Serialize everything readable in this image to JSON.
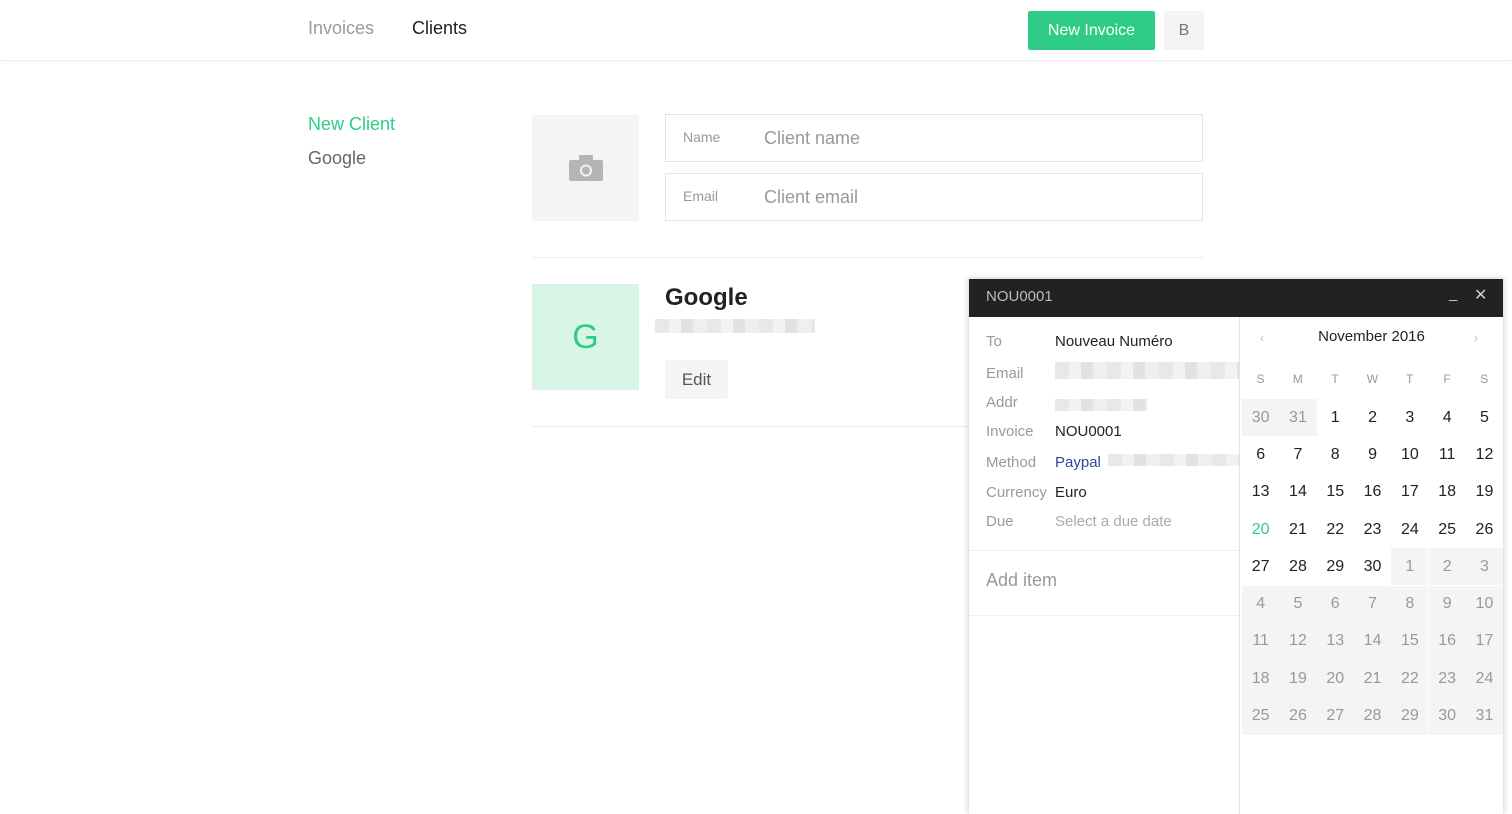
{
  "topbar": {
    "nav": [
      "Invoices",
      "Clients"
    ],
    "new_invoice_label": "New Invoice",
    "user_initial": "B"
  },
  "sidebar": {
    "items": [
      {
        "label": "New Client",
        "active": true
      },
      {
        "label": "Google",
        "active": false
      }
    ]
  },
  "new_client_form": {
    "name_label": "Name",
    "name_placeholder": "Client name",
    "email_label": "Email",
    "email_placeholder": "Client email",
    "photo_icon": "camera-icon"
  },
  "client_card": {
    "avatar_letter": "G",
    "name": "Google",
    "edit_label": "Edit"
  },
  "invoice_popup": {
    "title": "NOU0001",
    "minimize_glyph": "_",
    "close_glyph": "✕",
    "rows": {
      "to_label": "To",
      "to_value": "Nouveau Numéro",
      "email_label": "Email",
      "addr_label": "Addr",
      "invoice_label": "Invoice",
      "invoice_value": "NOU0001",
      "method_label": "Method",
      "method_value": "Paypal",
      "currency_label": "Currency",
      "currency_value": "Euro",
      "due_label": "Due",
      "due_placeholder": "Select a due date"
    },
    "add_item_label": "Add item"
  },
  "calendar": {
    "month_title": "November 2016",
    "prev_glyph": "‹",
    "next_glyph": "›",
    "weekdays": [
      "S",
      "M",
      "T",
      "W",
      "T",
      "F",
      "S"
    ],
    "today": 20,
    "weeks": [
      [
        [
          30,
          "other"
        ],
        [
          31,
          "other"
        ],
        [
          1,
          "in"
        ],
        [
          2,
          "in"
        ],
        [
          3,
          "in"
        ],
        [
          4,
          "in"
        ],
        [
          5,
          "in"
        ]
      ],
      [
        [
          6,
          "in"
        ],
        [
          7,
          "in"
        ],
        [
          8,
          "in"
        ],
        [
          9,
          "in"
        ],
        [
          10,
          "in"
        ],
        [
          11,
          "in"
        ],
        [
          12,
          "in"
        ]
      ],
      [
        [
          13,
          "in"
        ],
        [
          14,
          "in"
        ],
        [
          15,
          "in"
        ],
        [
          16,
          "in"
        ],
        [
          17,
          "in"
        ],
        [
          18,
          "in"
        ],
        [
          19,
          "in"
        ]
      ],
      [
        [
          20,
          "today"
        ],
        [
          21,
          "in"
        ],
        [
          22,
          "in"
        ],
        [
          23,
          "in"
        ],
        [
          24,
          "in"
        ],
        [
          25,
          "in"
        ],
        [
          26,
          "in"
        ]
      ],
      [
        [
          27,
          "in"
        ],
        [
          28,
          "in"
        ],
        [
          29,
          "in"
        ],
        [
          30,
          "in"
        ],
        [
          1,
          "other"
        ],
        [
          2,
          "other"
        ],
        [
          3,
          "other"
        ]
      ],
      [
        [
          4,
          "other"
        ],
        [
          5,
          "other"
        ],
        [
          6,
          "other"
        ],
        [
          7,
          "other"
        ],
        [
          8,
          "other"
        ],
        [
          9,
          "other"
        ],
        [
          10,
          "other"
        ]
      ],
      [
        [
          11,
          "other"
        ],
        [
          12,
          "other"
        ],
        [
          13,
          "other"
        ],
        [
          14,
          "other"
        ],
        [
          15,
          "other"
        ],
        [
          16,
          "other"
        ],
        [
          17,
          "other"
        ]
      ],
      [
        [
          18,
          "other"
        ],
        [
          19,
          "other"
        ],
        [
          20,
          "other"
        ],
        [
          21,
          "other"
        ],
        [
          22,
          "other"
        ],
        [
          23,
          "other"
        ],
        [
          24,
          "other"
        ]
      ],
      [
        [
          25,
          "other"
        ],
        [
          26,
          "other"
        ],
        [
          27,
          "other"
        ],
        [
          28,
          "other"
        ],
        [
          29,
          "other"
        ],
        [
          30,
          "other"
        ],
        [
          31,
          "other"
        ]
      ]
    ]
  },
  "colors": {
    "accent": "#2ecc87",
    "avatar_bg": "#d8f5e6",
    "header_dark": "#222222",
    "link": "#2b4a8f"
  }
}
